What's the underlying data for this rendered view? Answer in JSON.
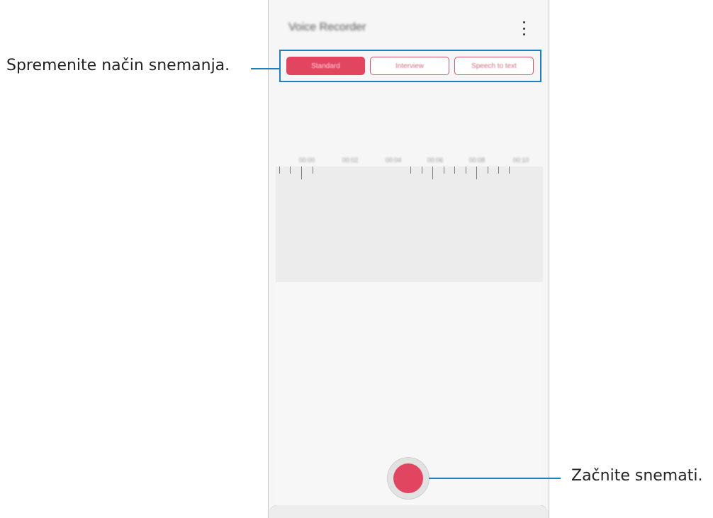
{
  "app": {
    "title": "Voice Recorder",
    "more_options_icon": "more-vertical-icon"
  },
  "modes": [
    {
      "label": "Standard",
      "selected": true
    },
    {
      "label": "Interview",
      "selected": false
    },
    {
      "label": "Speech to text",
      "selected": false
    }
  ],
  "timeline": {
    "labels": [
      "00:00",
      "00:02",
      "00:04",
      "00:06",
      "00:08",
      "00:10"
    ]
  },
  "record": {
    "icon": "record-icon"
  },
  "callouts": {
    "mode": "Spremenite način snemanja.",
    "record": "Začnite snemati."
  },
  "colors": {
    "accent": "#e24560",
    "callout_line": "#1e7fc1"
  }
}
